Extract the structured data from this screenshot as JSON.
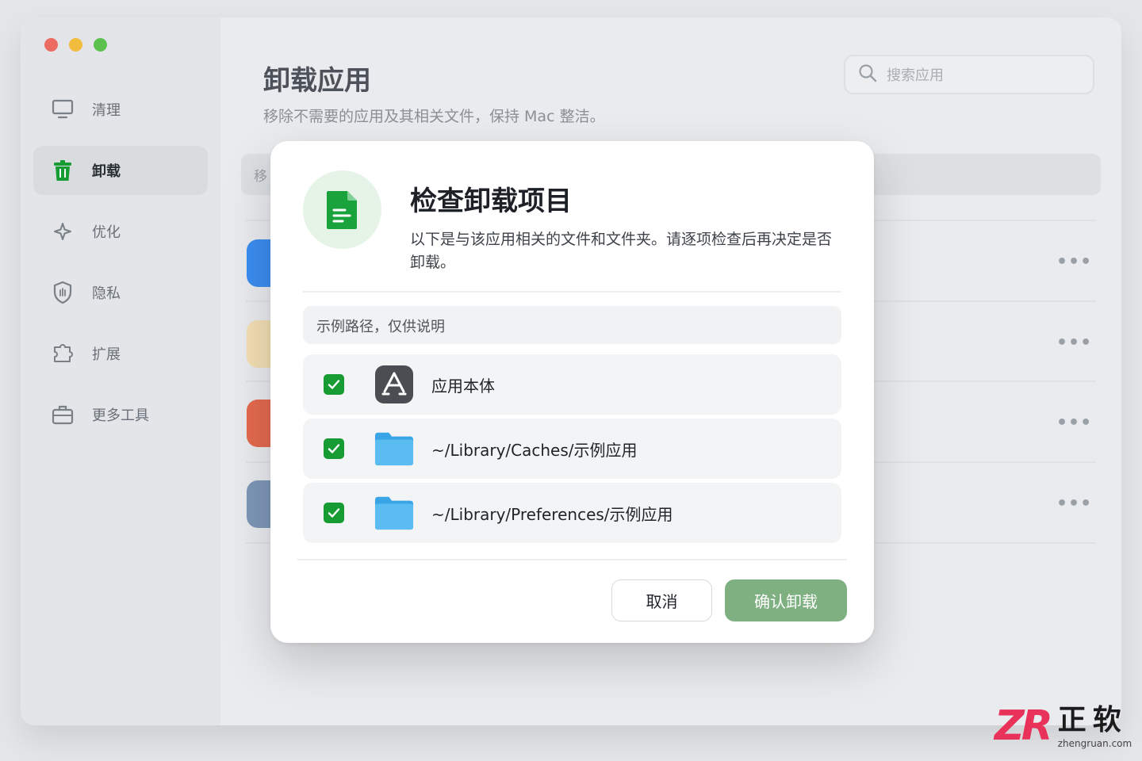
{
  "window": {
    "title": "卸载应用",
    "subtitle": "移除不需要的应用及其相关文件，保持 Mac 整洁。",
    "search_placeholder": "搜索应用",
    "toolbar_text": "移"
  },
  "sidebar": {
    "items": [
      {
        "label": "清理",
        "icon": "monitor-icon",
        "active": false
      },
      {
        "label": "卸载",
        "icon": "trash-icon",
        "active": true
      },
      {
        "label": "优化",
        "icon": "sparkle-icon",
        "active": false
      },
      {
        "label": "隐私",
        "icon": "shield-hand-icon",
        "active": false
      },
      {
        "label": "扩展",
        "icon": "puzzle-icon",
        "active": false
      },
      {
        "label": "更多工具",
        "icon": "toolbox-icon",
        "active": false
      }
    ]
  },
  "app_list": {
    "row_more": "•••"
  },
  "dialog": {
    "title": "检查卸载项目",
    "description": "以下是与该应用相关的文件和文件夹。请逐项检查后再决定是否卸载。",
    "path_hint": "示例路径，仅供说明",
    "items": [
      {
        "label": "应用本体",
        "icon": "app-store-icon",
        "checked": true
      },
      {
        "label": "~/Library/Caches/示例应用",
        "icon": "folder-icon",
        "checked": true
      },
      {
        "label": "~/Library/Preferences/示例应用",
        "icon": "folder-icon",
        "checked": true
      }
    ],
    "cancel_label": "取消",
    "confirm_label": "确认卸载"
  },
  "colors": {
    "accent_green": "#169c33",
    "confirm_button": "#7fb082",
    "folder_blue": "#5bbcf2"
  },
  "watermark": {
    "logo": "ZR",
    "name": "正软",
    "url": "zhengruan.com"
  }
}
